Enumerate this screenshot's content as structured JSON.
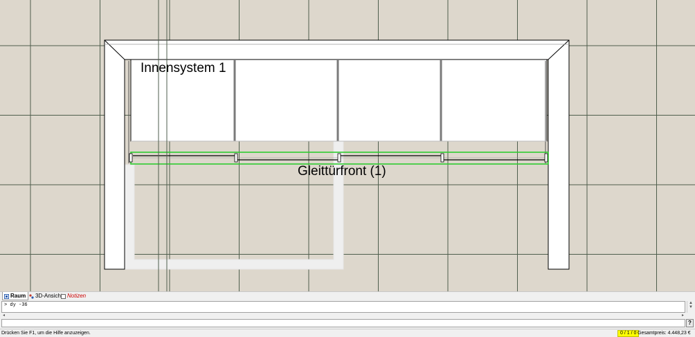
{
  "viewport": {
    "labels": {
      "inner_system": "Innensystem 1",
      "sliding_door_front": "Gleittürfront (1)"
    },
    "colors": {
      "floor": "#ddd7cc",
      "grid": "#4e5e4c",
      "selection": "#2ecc2e"
    }
  },
  "tabs": [
    {
      "label": "Raum",
      "icon": "room-view-icon"
    },
    {
      "label": "3D-Ansicht",
      "icon": "3d-view-icon"
    },
    {
      "label": "Notizen",
      "icon": "notes-icon"
    }
  ],
  "command_log": {
    "line": "> dy -36"
  },
  "command_input": {
    "value": ""
  },
  "help_button": "?",
  "status_bar": {
    "hint": "Drücken Sie F1, um die Hilfe anzuzeigen.",
    "counter": "0 / 1 / 0",
    "total_price": "Gesamtpreis: 4.448,23 €"
  }
}
